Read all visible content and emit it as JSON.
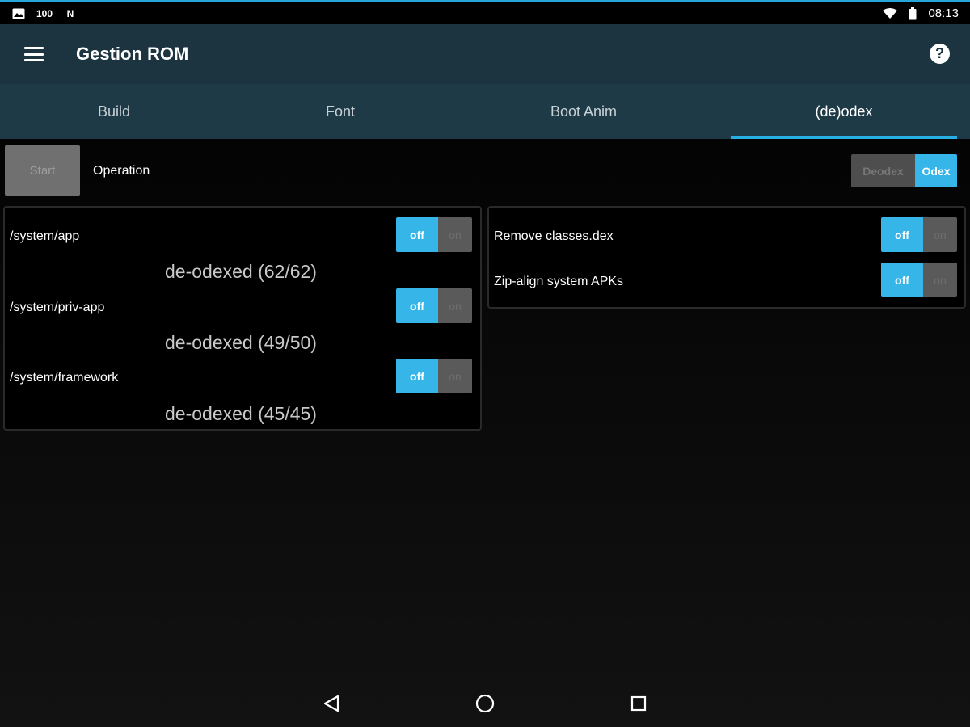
{
  "status_bar": {
    "left_icons": [
      "image-icon",
      "notification-100-icon",
      "n-icon"
    ],
    "notification_text": "100",
    "n_text": "N",
    "right_icons": [
      "wifi-icon",
      "battery-icon"
    ],
    "time": "08:13"
  },
  "action_bar": {
    "title": "Gestion ROM",
    "menu_icon": "hamburger-menu-icon",
    "help_icon": "help-icon",
    "help_glyph": "?"
  },
  "tabs": [
    {
      "label": "Build",
      "active": false
    },
    {
      "label": "Font",
      "active": false
    },
    {
      "label": "Boot Anim",
      "active": false
    },
    {
      "label": "(de)odex",
      "active": true
    }
  ],
  "operation": {
    "start_label": "Start",
    "label": "Operation",
    "mode_options": [
      "Deodex",
      "Odex"
    ],
    "selected_mode": "Odex"
  },
  "left_panel": {
    "rows": [
      {
        "path": "/system/app",
        "toggle_off": "off",
        "toggle_on": "on",
        "state": "off",
        "status": "de-odexed (62/62)"
      },
      {
        "path": "/system/priv-app",
        "toggle_off": "off",
        "toggle_on": "on",
        "state": "off",
        "status": "de-odexed (49/50)"
      },
      {
        "path": "/system/framework",
        "toggle_off": "off",
        "toggle_on": "on",
        "state": "off",
        "status": "de-odexed (45/45)"
      }
    ]
  },
  "right_panel": {
    "rows": [
      {
        "label": "Remove classes.dex",
        "toggle_off": "off",
        "toggle_on": "on",
        "state": "off"
      },
      {
        "label": "Zip-align system APKs",
        "toggle_off": "off",
        "toggle_on": "on",
        "state": "off"
      }
    ]
  },
  "nav_bar": {
    "buttons": [
      "back-icon",
      "home-icon",
      "recents-icon"
    ]
  },
  "colors": {
    "accent": "#27aee2",
    "toggle_active": "#36b5e8",
    "action_bar": "#1c3340",
    "tab_bar": "#1f3a47"
  }
}
